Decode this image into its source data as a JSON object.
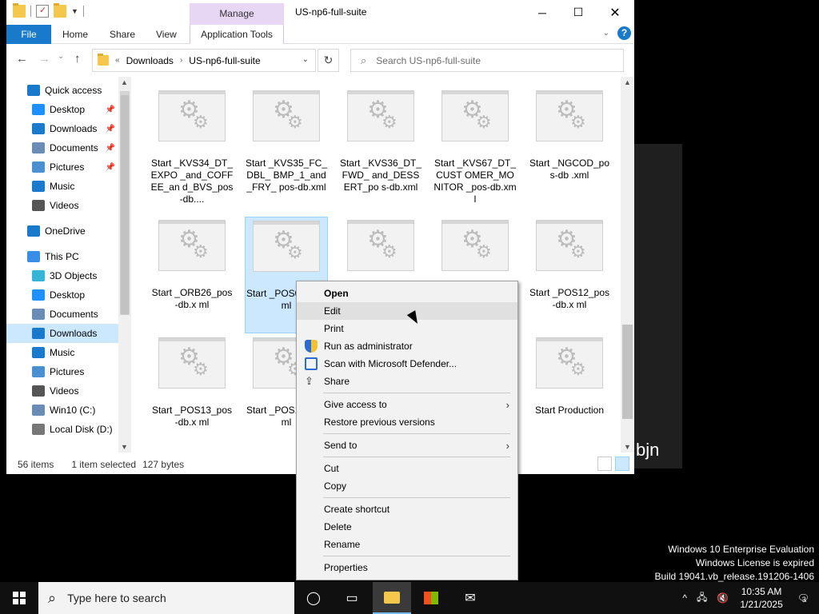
{
  "background_window": {
    "text": "bjn"
  },
  "window": {
    "title": "US-np6-full-suite",
    "manage_tab": "Manage",
    "ribbon_tabs": [
      "File",
      "Home",
      "Share",
      "View",
      "Application Tools"
    ]
  },
  "address": {
    "prefix": "«",
    "segments": [
      "Downloads",
      "US-np6-full-suite"
    ],
    "search_placeholder": "Search US-np6-full-suite"
  },
  "nav": {
    "items": [
      {
        "label": "Quick access",
        "icon": "star-icon",
        "color": "#1979ca",
        "indent": 0,
        "pin": false
      },
      {
        "label": "Desktop",
        "icon": "desktop-icon",
        "color": "#1e90ff",
        "indent": 1,
        "pin": true
      },
      {
        "label": "Downloads",
        "icon": "download-icon",
        "color": "#1979ca",
        "indent": 1,
        "pin": true
      },
      {
        "label": "Documents",
        "icon": "documents-icon",
        "color": "#6b8db5",
        "indent": 1,
        "pin": true
      },
      {
        "label": "Pictures",
        "icon": "pictures-icon",
        "color": "#4a8fd0",
        "indent": 1,
        "pin": true
      },
      {
        "label": "Music",
        "icon": "music-icon",
        "color": "#1979ca",
        "indent": 1,
        "pin": false
      },
      {
        "label": "Videos",
        "icon": "videos-icon",
        "color": "#555",
        "indent": 1,
        "pin": false
      },
      {
        "label": "OneDrive",
        "icon": "cloud-icon",
        "color": "#1979ca",
        "indent": 0,
        "pin": false
      },
      {
        "label": "This PC",
        "icon": "pc-icon",
        "color": "#3a8ee6",
        "indent": 0,
        "pin": false
      },
      {
        "label": "3D Objects",
        "icon": "cube-icon",
        "color": "#36b5d8",
        "indent": 1,
        "pin": false
      },
      {
        "label": "Desktop",
        "icon": "desktop-icon",
        "color": "#1e90ff",
        "indent": 1,
        "pin": false
      },
      {
        "label": "Documents",
        "icon": "documents-icon",
        "color": "#6b8db5",
        "indent": 1,
        "pin": false
      },
      {
        "label": "Downloads",
        "icon": "download-icon",
        "color": "#1979ca",
        "indent": 1,
        "pin": false,
        "selected": true
      },
      {
        "label": "Music",
        "icon": "music-icon",
        "color": "#1979ca",
        "indent": 1,
        "pin": false
      },
      {
        "label": "Pictures",
        "icon": "pictures-icon",
        "color": "#4a8fd0",
        "indent": 1,
        "pin": false
      },
      {
        "label": "Videos",
        "icon": "videos-icon",
        "color": "#555",
        "indent": 1,
        "pin": false
      },
      {
        "label": "Win10 (C:)",
        "icon": "drive-icon",
        "color": "#6b8db5",
        "indent": 1,
        "pin": false
      },
      {
        "label": "Local Disk (D:)",
        "icon": "disk-icon",
        "color": "#777",
        "indent": 1,
        "pin": false
      }
    ]
  },
  "files": [
    {
      "name": "Start _KVS34_DT_EXPO _and_COFFEE_an d_BVS_pos-db....",
      "selected": false
    },
    {
      "name": "Start _KVS35_FC_DBL_ BMP_1_and_FRY_ pos-db.xml",
      "selected": false
    },
    {
      "name": "Start _KVS36_DT_FWD_ and_DESSERT_po s-db.xml",
      "selected": false
    },
    {
      "name": "Start _KVS67_DT_CUST OMER_MONITOR _pos-db.xml",
      "selected": false
    },
    {
      "name": "Start _NGCOD_pos-db .xml",
      "selected": false
    },
    {
      "name": "Start _ORB26_pos-db.x ml",
      "selected": false
    },
    {
      "name": "Start _POS01_pos ml",
      "selected": true
    },
    {
      "name": "",
      "selected": false
    },
    {
      "name": "",
      "selected": false
    },
    {
      "name": "Start _POS12_pos-db.x ml",
      "selected": false
    },
    {
      "name": "Start _POS13_pos-db.x ml",
      "selected": false
    },
    {
      "name": "Start _POS14_pos ml",
      "selected": false
    },
    {
      "name": "",
      "selected": false
    },
    {
      "name": "",
      "selected": false
    },
    {
      "name": "Start Production",
      "selected": false
    }
  ],
  "status": {
    "count": "56 items",
    "selected": "1 item selected",
    "size": "127 bytes"
  },
  "context_menu": {
    "items": [
      {
        "label": "Open",
        "bold": true
      },
      {
        "label": "Edit",
        "hover": true
      },
      {
        "label": "Print"
      },
      {
        "label": "Run as administrator",
        "icon": "shield-icon"
      },
      {
        "label": "Scan with Microsoft Defender...",
        "icon": "defender-icon"
      },
      {
        "label": "Share",
        "icon": "share-icon"
      },
      {
        "sep": true
      },
      {
        "label": "Give access to",
        "submenu": true
      },
      {
        "label": "Restore previous versions"
      },
      {
        "sep": true
      },
      {
        "label": "Send to",
        "submenu": true
      },
      {
        "sep": true
      },
      {
        "label": "Cut"
      },
      {
        "label": "Copy"
      },
      {
        "sep": true
      },
      {
        "label": "Create shortcut"
      },
      {
        "label": "Delete"
      },
      {
        "label": "Rename"
      },
      {
        "sep": true
      },
      {
        "label": "Properties"
      }
    ]
  },
  "watermark": {
    "line1": "Windows 10 Enterprise Evaluation",
    "line2": "Windows License is expired",
    "line3": "Build 19041.vb_release.191206-1406"
  },
  "taskbar": {
    "search_placeholder": "Type here to search",
    "time": "10:35 AM",
    "date": "1/21/2025",
    "notifications": "3"
  }
}
